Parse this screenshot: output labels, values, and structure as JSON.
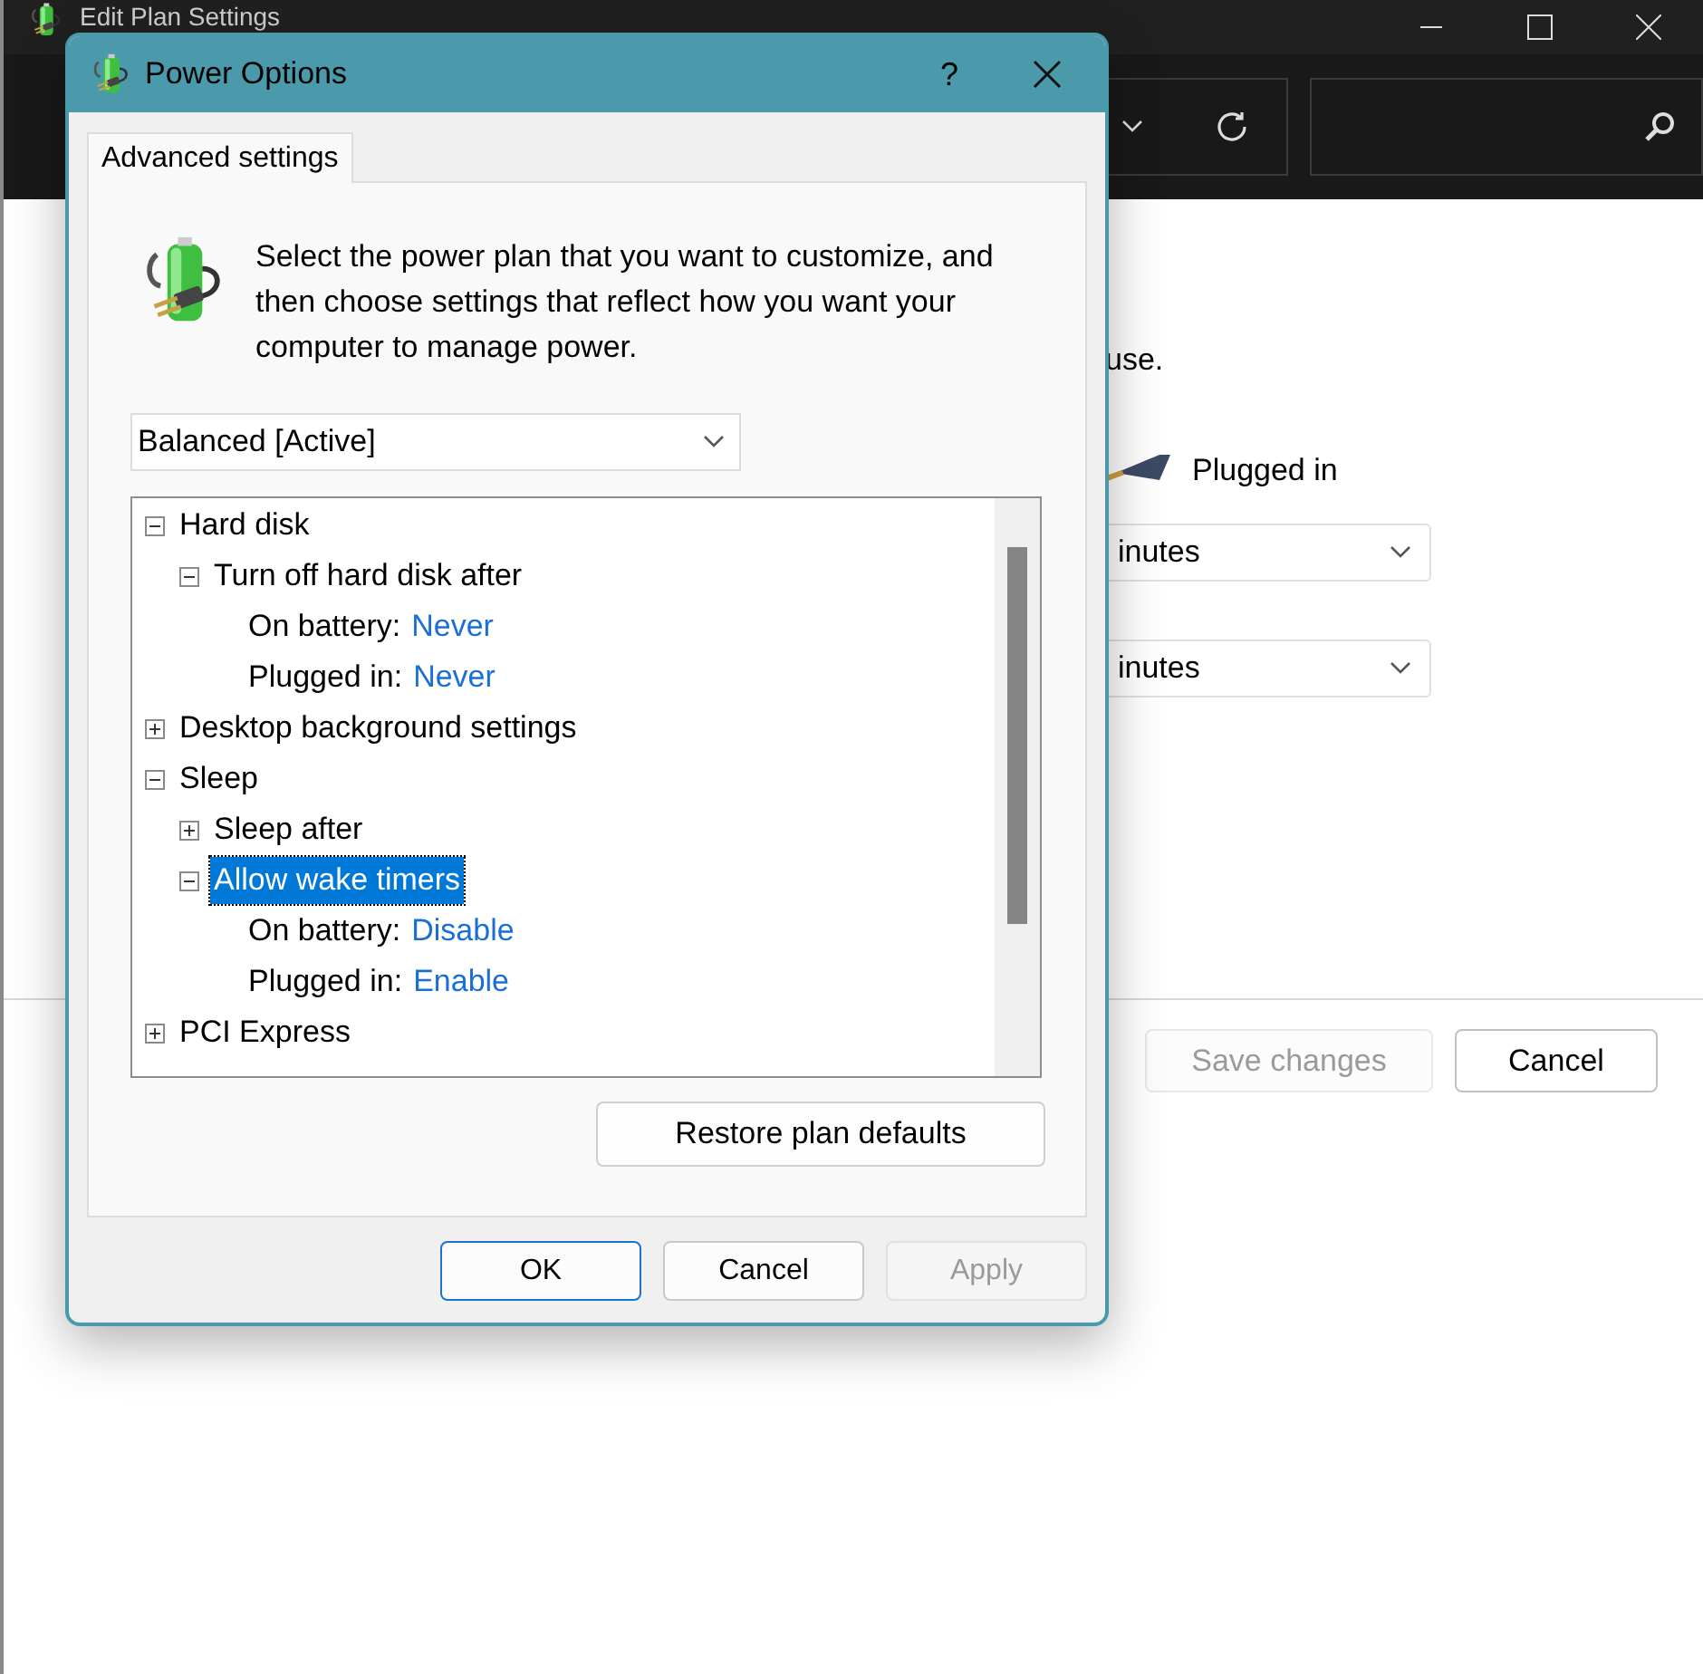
{
  "window": {
    "title": "Edit Plan Settings"
  },
  "background": {
    "note": "use.",
    "plugged_label": "Plugged in",
    "selects": [
      {
        "value": "inutes"
      },
      {
        "value": "inutes"
      }
    ],
    "buttons": [
      {
        "label": "Save changes",
        "disabled": true
      },
      {
        "label": "Cancel",
        "disabled": false
      }
    ]
  },
  "dialog": {
    "title": "Power Options",
    "help": "?",
    "tabs": [
      {
        "label": "Advanced settings",
        "selected": true
      }
    ],
    "intro": "Select the power plan that you want to customize, and then choose settings that reflect how you want your computer to manage power.",
    "plan": "Balanced [Active]",
    "tree": [
      {
        "label": "Hard disk",
        "expanded": true,
        "selected": false,
        "children": [
          {
            "label": "Turn off hard disk after",
            "expanded": true,
            "selected": false,
            "children": [
              {
                "kind": "value",
                "label": "On battery:",
                "value": "Never"
              },
              {
                "kind": "value",
                "label": "Plugged in:",
                "value": "Never"
              }
            ]
          }
        ]
      },
      {
        "label": "Desktop background settings",
        "expanded": false,
        "selected": false
      },
      {
        "label": "Sleep",
        "expanded": true,
        "selected": false,
        "children": [
          {
            "label": "Sleep after",
            "expanded": false,
            "selected": false
          },
          {
            "label": "Allow wake timers",
            "expanded": true,
            "selected": true,
            "children": [
              {
                "kind": "value",
                "label": "On battery:",
                "value": "Disable"
              },
              {
                "kind": "value",
                "label": "Plugged in:",
                "value": "Enable"
              }
            ]
          }
        ]
      },
      {
        "label": "PCI Express",
        "expanded": false,
        "selected": false
      }
    ],
    "restore": "Restore plan defaults",
    "buttons": [
      {
        "label": "OK",
        "disabled": false,
        "default": true
      },
      {
        "label": "Cancel",
        "disabled": false,
        "default": false
      },
      {
        "label": "Apply",
        "disabled": true,
        "default": false
      }
    ]
  }
}
